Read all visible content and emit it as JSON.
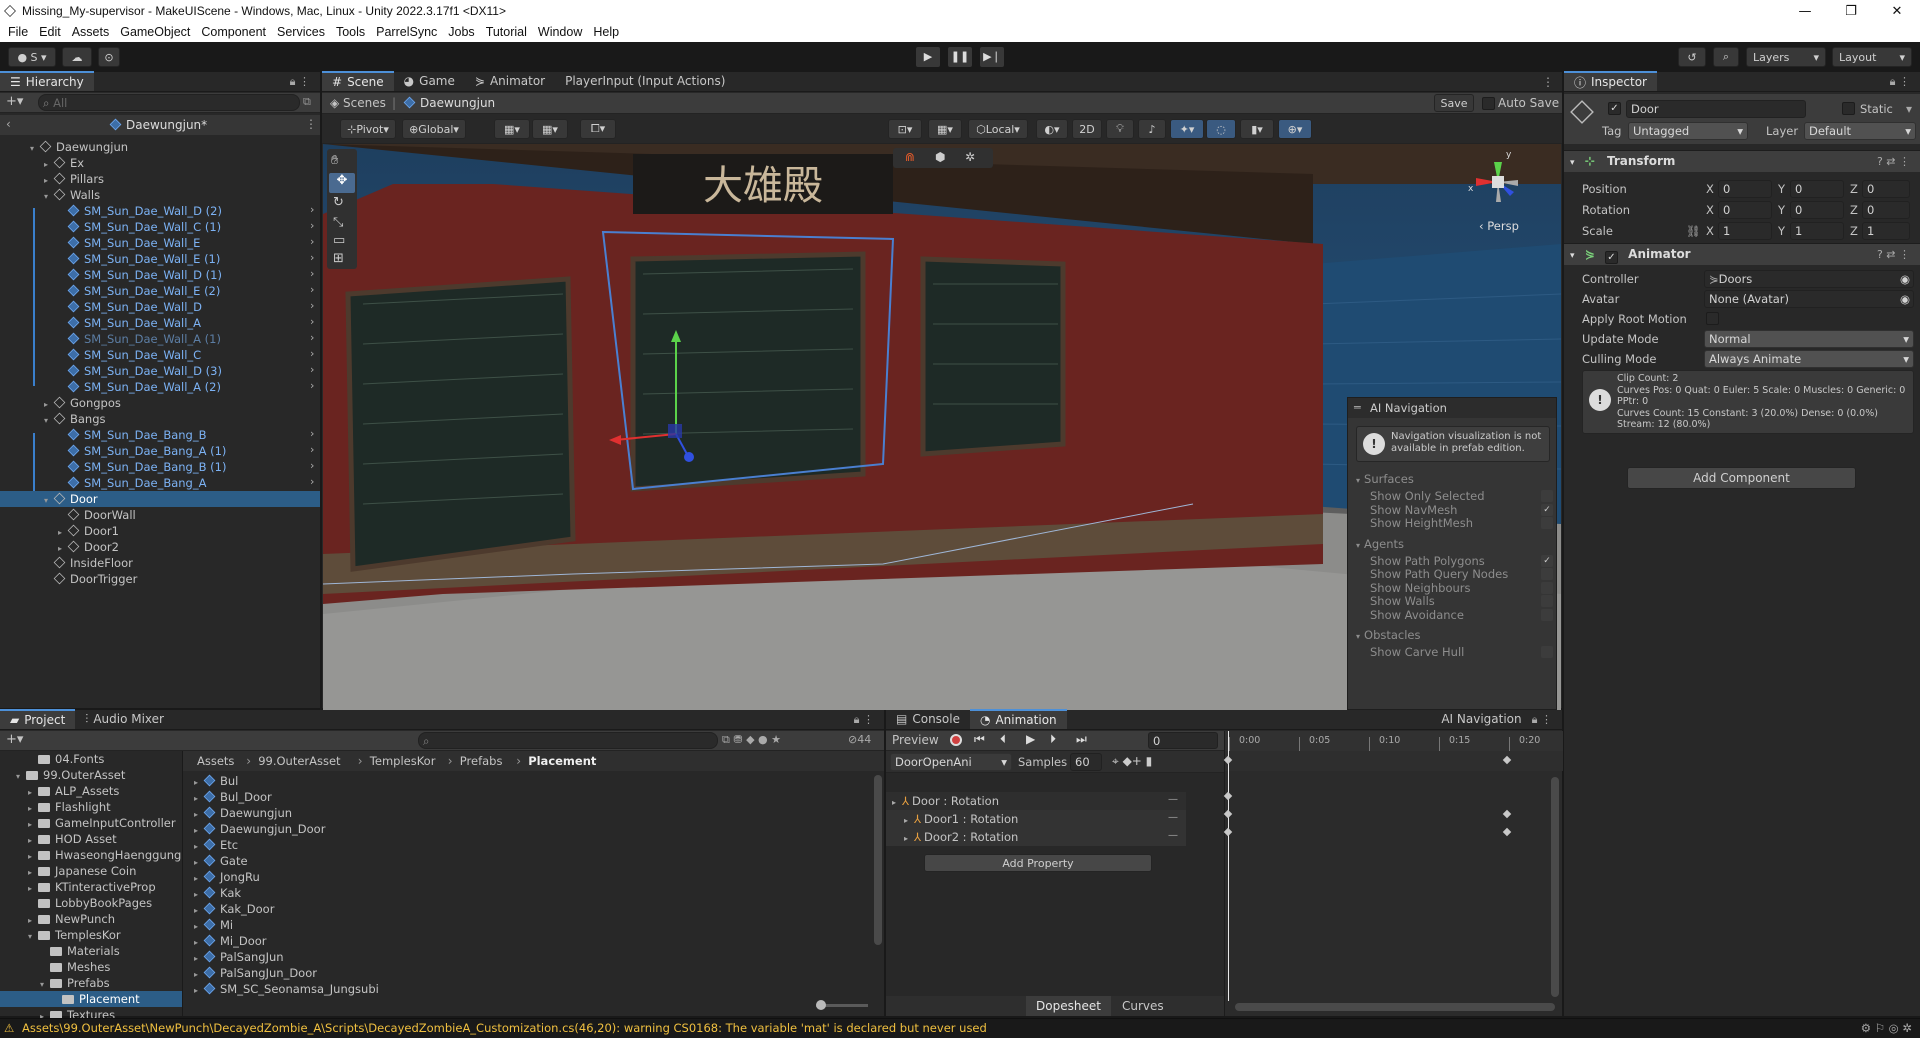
{
  "window": {
    "title": "Missing_My-supervisor - MakeUIScene - Windows, Mac, Linux - Unity 2022.3.17f1 <DX11>",
    "controls": [
      "—",
      "❐",
      "✕"
    ]
  },
  "menu": [
    "File",
    "Edit",
    "Assets",
    "GameObject",
    "Component",
    "Services",
    "Tools",
    "ParrelSync",
    "Jobs",
    "Tutorial",
    "Window",
    "Help"
  ],
  "toolbar": {
    "account": "S",
    "layers": "Layers",
    "layout": "Layout"
  },
  "hierarchy": {
    "tab": "Hierarchy",
    "search_placeholder": "All",
    "root": "Daewungjun*",
    "items": [
      {
        "label": "Daewungjun",
        "depth": 1,
        "fold": "▾",
        "style": "normal"
      },
      {
        "label": "Ex",
        "depth": 2,
        "fold": "▸",
        "style": "normal"
      },
      {
        "label": "Pillars",
        "depth": 2,
        "fold": "▸",
        "style": "normal"
      },
      {
        "label": "Walls",
        "depth": 2,
        "fold": "▾",
        "style": "normal"
      },
      {
        "label": "SM_Sun_Dae_Wall_D (2)",
        "depth": 3,
        "fold": "",
        "style": "blue"
      },
      {
        "label": "SM_Sun_Dae_Wall_C (1)",
        "depth": 3,
        "fold": "",
        "style": "blue"
      },
      {
        "label": "SM_Sun_Dae_Wall_E",
        "depth": 3,
        "fold": "",
        "style": "blue"
      },
      {
        "label": "SM_Sun_Dae_Wall_E (1)",
        "depth": 3,
        "fold": "",
        "style": "blue"
      },
      {
        "label": "SM_Sun_Dae_Wall_D (1)",
        "depth": 3,
        "fold": "",
        "style": "blue"
      },
      {
        "label": "SM_Sun_Dae_Wall_E (2)",
        "depth": 3,
        "fold": "",
        "style": "blue"
      },
      {
        "label": "SM_Sun_Dae_Wall_D",
        "depth": 3,
        "fold": "",
        "style": "blue"
      },
      {
        "label": "SM_Sun_Dae_Wall_A",
        "depth": 3,
        "fold": "",
        "style": "blue"
      },
      {
        "label": "SM_Sun_Dae_Wall_A (1)",
        "depth": 3,
        "fold": "",
        "style": "dim"
      },
      {
        "label": "SM_Sun_Dae_Wall_C",
        "depth": 3,
        "fold": "",
        "style": "blue"
      },
      {
        "label": "SM_Sun_Dae_Wall_D (3)",
        "depth": 3,
        "fold": "",
        "style": "blue"
      },
      {
        "label": "SM_Sun_Dae_Wall_A (2)",
        "depth": 3,
        "fold": "",
        "style": "blue"
      },
      {
        "label": "Gongpos",
        "depth": 2,
        "fold": "▸",
        "style": "normal"
      },
      {
        "label": "Bangs",
        "depth": 2,
        "fold": "▾",
        "style": "normal"
      },
      {
        "label": "SM_Sun_Dae_Bang_B",
        "depth": 3,
        "fold": "",
        "style": "blue"
      },
      {
        "label": "SM_Sun_Dae_Bang_A (1)",
        "depth": 3,
        "fold": "",
        "style": "blue"
      },
      {
        "label": "SM_Sun_Dae_Bang_B (1)",
        "depth": 3,
        "fold": "",
        "style": "blue"
      },
      {
        "label": "SM_Sun_Dae_Bang_A",
        "depth": 3,
        "fold": "",
        "style": "blue"
      },
      {
        "label": "Door",
        "depth": 2,
        "fold": "▾",
        "style": "sel"
      },
      {
        "label": "DoorWall",
        "depth": 3,
        "fold": "",
        "style": "normal"
      },
      {
        "label": "Door1",
        "depth": 3,
        "fold": "▸",
        "style": "normal"
      },
      {
        "label": "Door2",
        "depth": 3,
        "fold": "▸",
        "style": "normal"
      },
      {
        "label": "InsideFloor",
        "depth": 2,
        "fold": "",
        "style": "normal"
      },
      {
        "label": "DoorTrigger",
        "depth": 2,
        "fold": "",
        "style": "normal"
      }
    ]
  },
  "scene_tabs": [
    "Scene",
    "Game",
    "Animator",
    "PlayerInput (Input Actions)"
  ],
  "scene_breadcrumb": {
    "scenes": "Scenes",
    "prefab": "Daewungjun",
    "save": "Save",
    "auto_save": "Auto Save"
  },
  "scene_toolbar": {
    "pivot": "Pivot",
    "global": "Global",
    "local": "Local",
    "mode_2d": "2D"
  },
  "gizmo": {
    "persp": "Persp",
    "x": "x",
    "y": "y"
  },
  "signboard": "大雄殿",
  "ai_navigation": {
    "title": "AI Navigation",
    "warning": "Navigation visualization is not available in prefab edition.",
    "sections": [
      {
        "name": "Surfaces",
        "items": [
          {
            "label": "Show Only Selected",
            "checked": false
          },
          {
            "label": "Show NavMesh",
            "checked": true
          },
          {
            "label": "Show HeightMesh",
            "checked": false
          }
        ]
      },
      {
        "name": "Agents",
        "items": [
          {
            "label": "Show Path Polygons",
            "checked": true
          },
          {
            "label": "Show Path Query Nodes",
            "checked": false
          },
          {
            "label": "Show Neighbours",
            "checked": false
          },
          {
            "label": "Show Walls",
            "checked": false
          },
          {
            "label": "Show Avoidance",
            "checked": false
          }
        ]
      },
      {
        "name": "Obstacles",
        "items": [
          {
            "label": "Show Carve Hull",
            "checked": false
          }
        ]
      }
    ]
  },
  "inspector": {
    "tab": "Inspector",
    "object_name": "Door",
    "static_label": "Static",
    "tag_label": "Tag",
    "tag_value": "Untagged",
    "layer_label": "Layer",
    "layer_value": "Default",
    "transform": {
      "title": "Transform",
      "position": {
        "label": "Position",
        "x": "0",
        "y": "0",
        "z": "0"
      },
      "rotation": {
        "label": "Rotation",
        "x": "0",
        "y": "0",
        "z": "0"
      },
      "scale": {
        "label": "Scale",
        "x": "1",
        "y": "1",
        "z": "1"
      },
      "axis": {
        "x": "X",
        "y": "Y",
        "z": "Z"
      }
    },
    "animator": {
      "title": "Animator",
      "controller_label": "Controller",
      "controller_value": "Doors",
      "avatar_label": "Avatar",
      "avatar_value": "None (Avatar)",
      "apply_root_motion_label": "Apply Root Motion",
      "update_mode_label": "Update Mode",
      "update_mode_value": "Normal",
      "culling_mode_label": "Culling Mode",
      "culling_mode_value": "Always Animate",
      "info": [
        "Clip Count: 2",
        "Curves Pos: 0 Quat: 0 Euler: 5 Scale: 0 Muscles: 0 Generic: 0",
        "PPtr: 0",
        "Curves Count: 15 Constant: 3 (20.0%) Dense: 0 (0.0%)",
        "Stream: 12 (80.0%)"
      ]
    },
    "add_component": "Add Component"
  },
  "project": {
    "tabs": [
      "Project",
      "Audio Mixer"
    ],
    "hidden_count": "44",
    "tree": [
      {
        "label": "04.Fonts",
        "depth": 2,
        "fold": ""
      },
      {
        "label": "99.OuterAsset",
        "depth": 1,
        "fold": "▾"
      },
      {
        "label": "ALP_Assets",
        "depth": 2,
        "fold": "▸"
      },
      {
        "label": "Flashlight",
        "depth": 2,
        "fold": "▸"
      },
      {
        "label": "GameInputController",
        "depth": 2,
        "fold": "▸"
      },
      {
        "label": "HOD Asset",
        "depth": 2,
        "fold": "▸"
      },
      {
        "label": "HwaseongHaenggung",
        "depth": 2,
        "fold": "▸"
      },
      {
        "label": "Japanese Coin",
        "depth": 2,
        "fold": "▸"
      },
      {
        "label": "KTinteractiveProp",
        "depth": 2,
        "fold": "▸"
      },
      {
        "label": "LobbyBookPages",
        "depth": 2,
        "fold": ""
      },
      {
        "label": "NewPunch",
        "depth": 2,
        "fold": "▸"
      },
      {
        "label": "TemplesKor",
        "depth": 2,
        "fold": "▾"
      },
      {
        "label": "Materials",
        "depth": 3,
        "fold": ""
      },
      {
        "label": "Meshes",
        "depth": 3,
        "fold": ""
      },
      {
        "label": "Prefabs",
        "depth": 3,
        "fold": "▾"
      },
      {
        "label": "Placement",
        "depth": 4,
        "fold": "",
        "sel": true
      },
      {
        "label": "Textures",
        "depth": 3,
        "fold": "▸"
      }
    ],
    "breadcrumb": [
      "Assets",
      "99.OuterAsset",
      "TemplesKor",
      "Prefabs",
      "Placement"
    ],
    "assets": [
      "Bul",
      "Bul_Door",
      "Daewungjun",
      "Daewungjun_Door",
      "Etc",
      "Gate",
      "JongRu",
      "Kak",
      "Kak_Door",
      "Mi",
      "Mi_Door",
      "PalSangJun",
      "PalSangJun_Door",
      "SM_SC_Seonamsa_Jungsubi"
    ]
  },
  "animation": {
    "tabs": [
      "Console",
      "Animation"
    ],
    "ai_nav_tab": "AI Navigation",
    "preview": "Preview",
    "frame": "0",
    "clip": "DoorOpenAni",
    "samples_label": "Samples",
    "samples_value": "60",
    "properties": [
      "Door : Rotation",
      "Door1 : Rotation",
      "Door2 : Rotation"
    ],
    "add_property": "Add Property",
    "times": [
      "0:00",
      "0:05",
      "0:10",
      "0:15",
      "0:20"
    ],
    "bottom_tabs": [
      "Dopesheet",
      "Curves"
    ]
  },
  "status": {
    "message": "Assets\\99.OuterAsset\\NewPunch\\DecayedZombie_A\\Scripts\\DecayedZombieA_Customization.cs(46,20): warning CS0168: The variable 'mat' is declared but never used"
  }
}
